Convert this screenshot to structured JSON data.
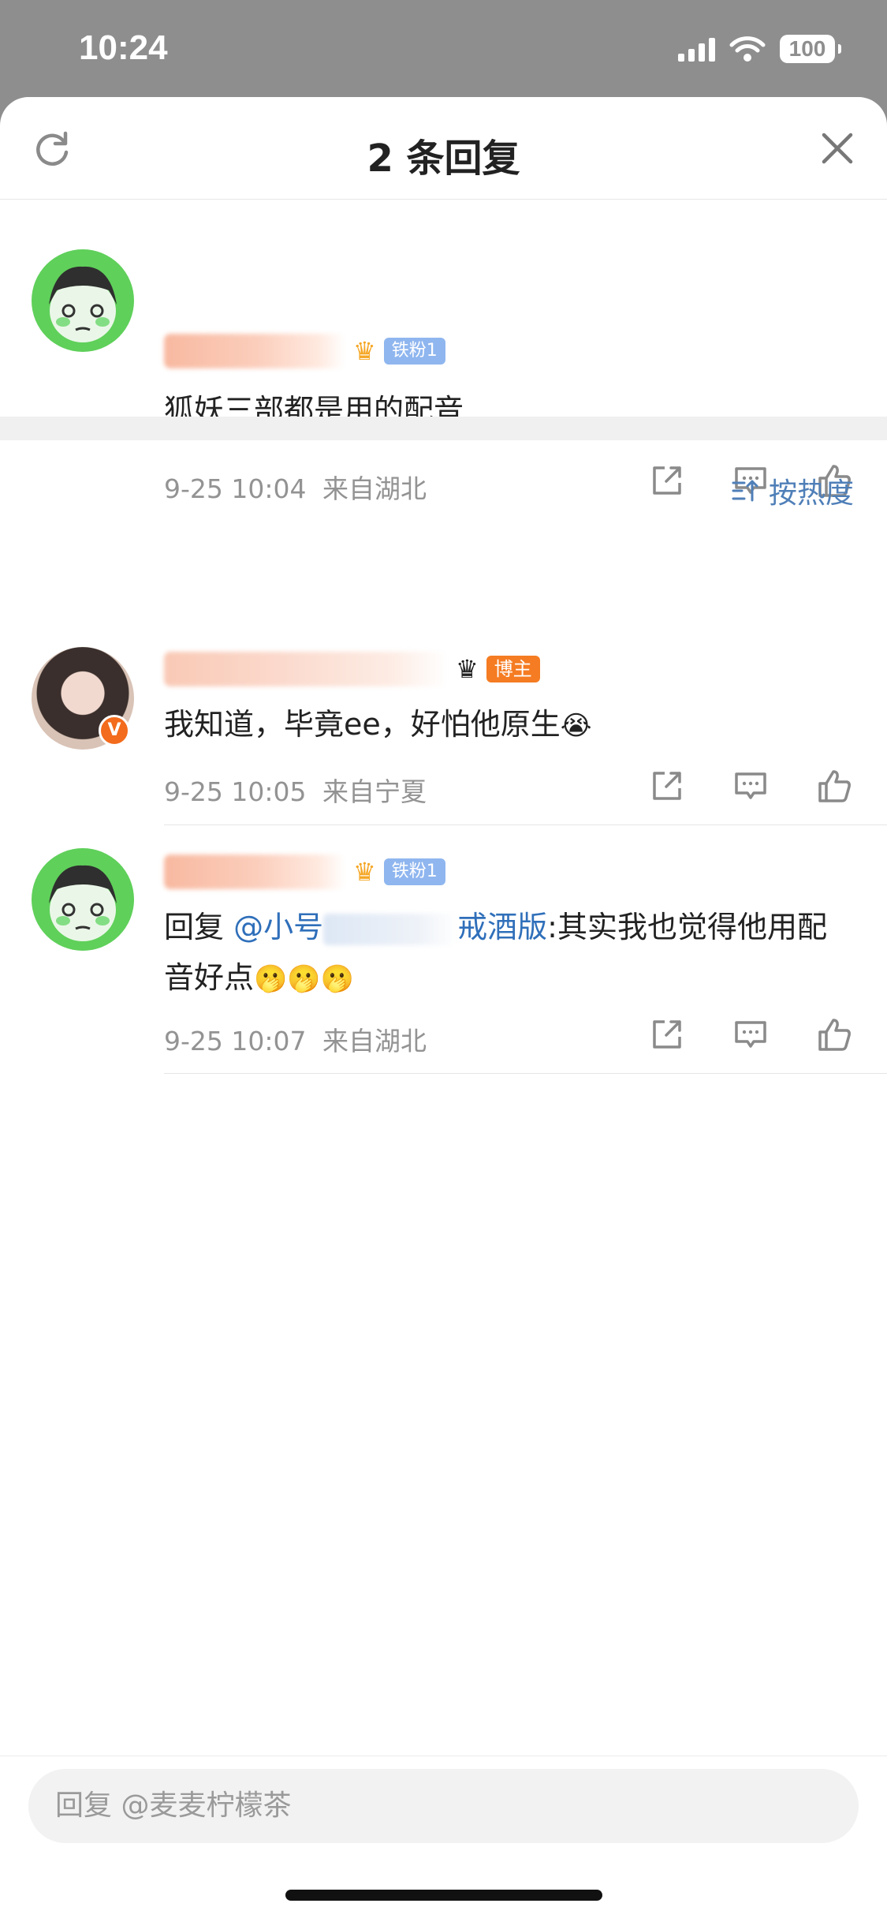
{
  "status_bar": {
    "time": "10:24",
    "battery": "100"
  },
  "header": {
    "title": "2 条回复"
  },
  "root_comment": {
    "badge": "铁粉1",
    "text": "狐妖三部都是用的配音",
    "time": "9-25 10:04",
    "location": "来自湖北"
  },
  "sort": {
    "label": "按热度"
  },
  "replies": [
    {
      "badge": "博主",
      "verified": "V",
      "text": "我知道，毕竟ee，好怕他原生",
      "emoji": "😭",
      "time": "9-25 10:05",
      "location": "来自宁夏"
    },
    {
      "badge": "铁粉1",
      "reply_prefix": "回复",
      "mention_start": "@小号",
      "mention_end": "戒酒版",
      "text": ":其实我也觉得他用配音好点",
      "emoji": "🫢🫢🫢",
      "time": "9-25 10:07",
      "location": "来自湖北"
    }
  ],
  "reply_input": {
    "placeholder": "回复 @麦麦柠檬茶"
  },
  "colors": {
    "accent": "#4f7fb8",
    "fan_badge": "#8fb6ef",
    "blogger_badge": "#f57c22",
    "verified": "#f36b1c"
  }
}
